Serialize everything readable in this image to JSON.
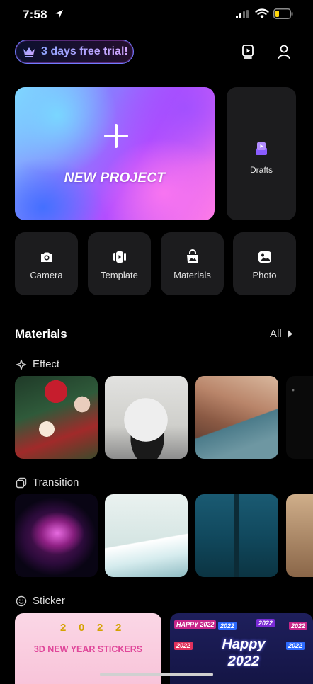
{
  "status_bar": {
    "time": "7:58"
  },
  "header": {
    "trial_label": "3 days free trial!",
    "icons": [
      "crown-icon",
      "play-icon",
      "profile-icon"
    ]
  },
  "new_project": {
    "label": "NEW PROJECT"
  },
  "drafts": {
    "label": "Drafts"
  },
  "quick_actions": [
    {
      "label": "Camera",
      "icon": "camera-icon"
    },
    {
      "label": "Template",
      "icon": "template-icon"
    },
    {
      "label": "Materials",
      "icon": "materials-icon"
    },
    {
      "label": "Photo",
      "icon": "photo-icon"
    }
  ],
  "materials": {
    "title": "Materials",
    "all_label": "All",
    "sections": [
      {
        "label": "Effect",
        "icon": "sparkle-icon"
      },
      {
        "label": "Transition",
        "icon": "transition-icon"
      },
      {
        "label": "Sticker",
        "icon": "sticker-icon"
      }
    ]
  },
  "stickers": {
    "card1_digits": [
      "2",
      "0",
      "2",
      "2"
    ],
    "card1_title": "3D NEW YEAR STICKERS",
    "card2_text_line1": "Happy",
    "card2_text_line2": "2022",
    "card2_mini": [
      "HAPPY 2022",
      "2022",
      "2022",
      "2022",
      "2022",
      "2022"
    ]
  },
  "colors": {
    "accent": "#6f7cff",
    "card_bg": "#1c1c1e",
    "background": "#000000"
  }
}
